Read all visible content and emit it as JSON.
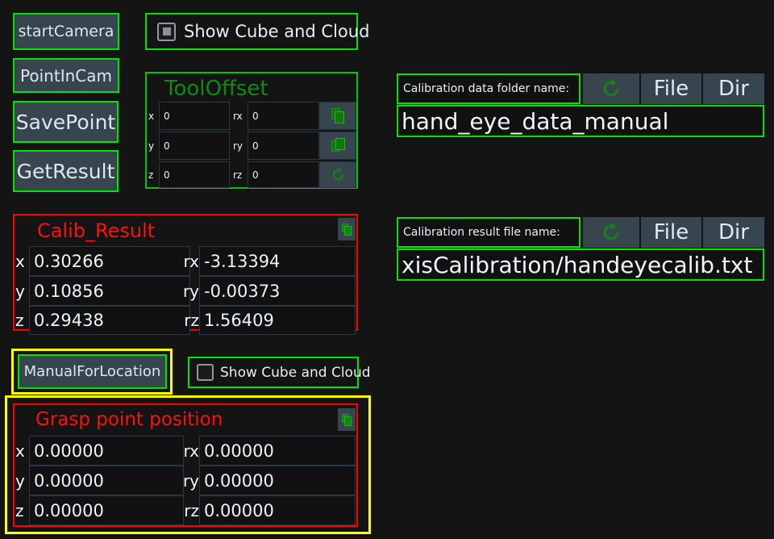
{
  "window": {
    "background": "#141414",
    "accent_green": "#00e500",
    "accent_red": "#ff0000",
    "accent_yellow": "#ffff00",
    "button_fill": "#36454e"
  },
  "left_buttons": [
    {
      "label": "startCamera"
    },
    {
      "label": "PointInCam"
    },
    {
      "label": "SavePoint"
    },
    {
      "label": "GetResult"
    }
  ],
  "show_cube_top": {
    "label": "Show Cube and Cloud",
    "state": "partial",
    "icon": "checkbox-partial-icon"
  },
  "tool_offset": {
    "title": "ToolOffset",
    "rows": [
      {
        "left_label": "x",
        "left_value": "0",
        "right_label": "rx",
        "right_value": "0",
        "icon": "copy-icon"
      },
      {
        "left_label": "y",
        "left_value": "0",
        "right_label": "ry",
        "right_value": "0",
        "icon": "copy-icon"
      },
      {
        "left_label": "z",
        "left_value": "0",
        "right_label": "rz",
        "right_value": "0",
        "icon": "refresh-icon"
      }
    ]
  },
  "calib_result": {
    "title": "Calib_Result",
    "header_icon": "copy-icon",
    "rows": [
      {
        "left_label": "x",
        "left_value": "0.30266",
        "right_label": "rx",
        "right_value": "-3.13394"
      },
      {
        "left_label": "y",
        "left_value": "0.10856",
        "right_label": "ry",
        "right_value": "-0.00373"
      },
      {
        "left_label": "z",
        "left_value": "0.29438",
        "right_label": "rz",
        "right_value": "1.56409"
      }
    ]
  },
  "manual_for_location": {
    "label": "ManualForLocation",
    "focused": true
  },
  "show_cube_bottom": {
    "label": "Show Cube and Cloud",
    "state": "unchecked",
    "icon": "checkbox-empty-icon"
  },
  "grasp_point": {
    "title": "Grasp point position",
    "header_icon": "copy-icon",
    "rows": [
      {
        "left_label": "x",
        "left_value": "0.00000",
        "right_label": "rx",
        "right_value": "0.00000"
      },
      {
        "left_label": "y",
        "left_value": "0.00000",
        "right_label": "ry",
        "right_value": "0.00000"
      },
      {
        "left_label": "z",
        "left_value": "0.00000",
        "right_label": "rz",
        "right_value": "0.00000"
      }
    ]
  },
  "calib_data_folder": {
    "label": "Calibration data folder name:",
    "refresh_icon": "refresh-icon",
    "file_button": "File",
    "dir_button": "Dir",
    "value": "hand_eye_data_manual"
  },
  "calib_result_file": {
    "label": "Calibration result file name:",
    "refresh_icon": "refresh-icon",
    "file_button": "File",
    "dir_button": "Dir",
    "value": "xisCalibration/handeyecalib.txt"
  }
}
